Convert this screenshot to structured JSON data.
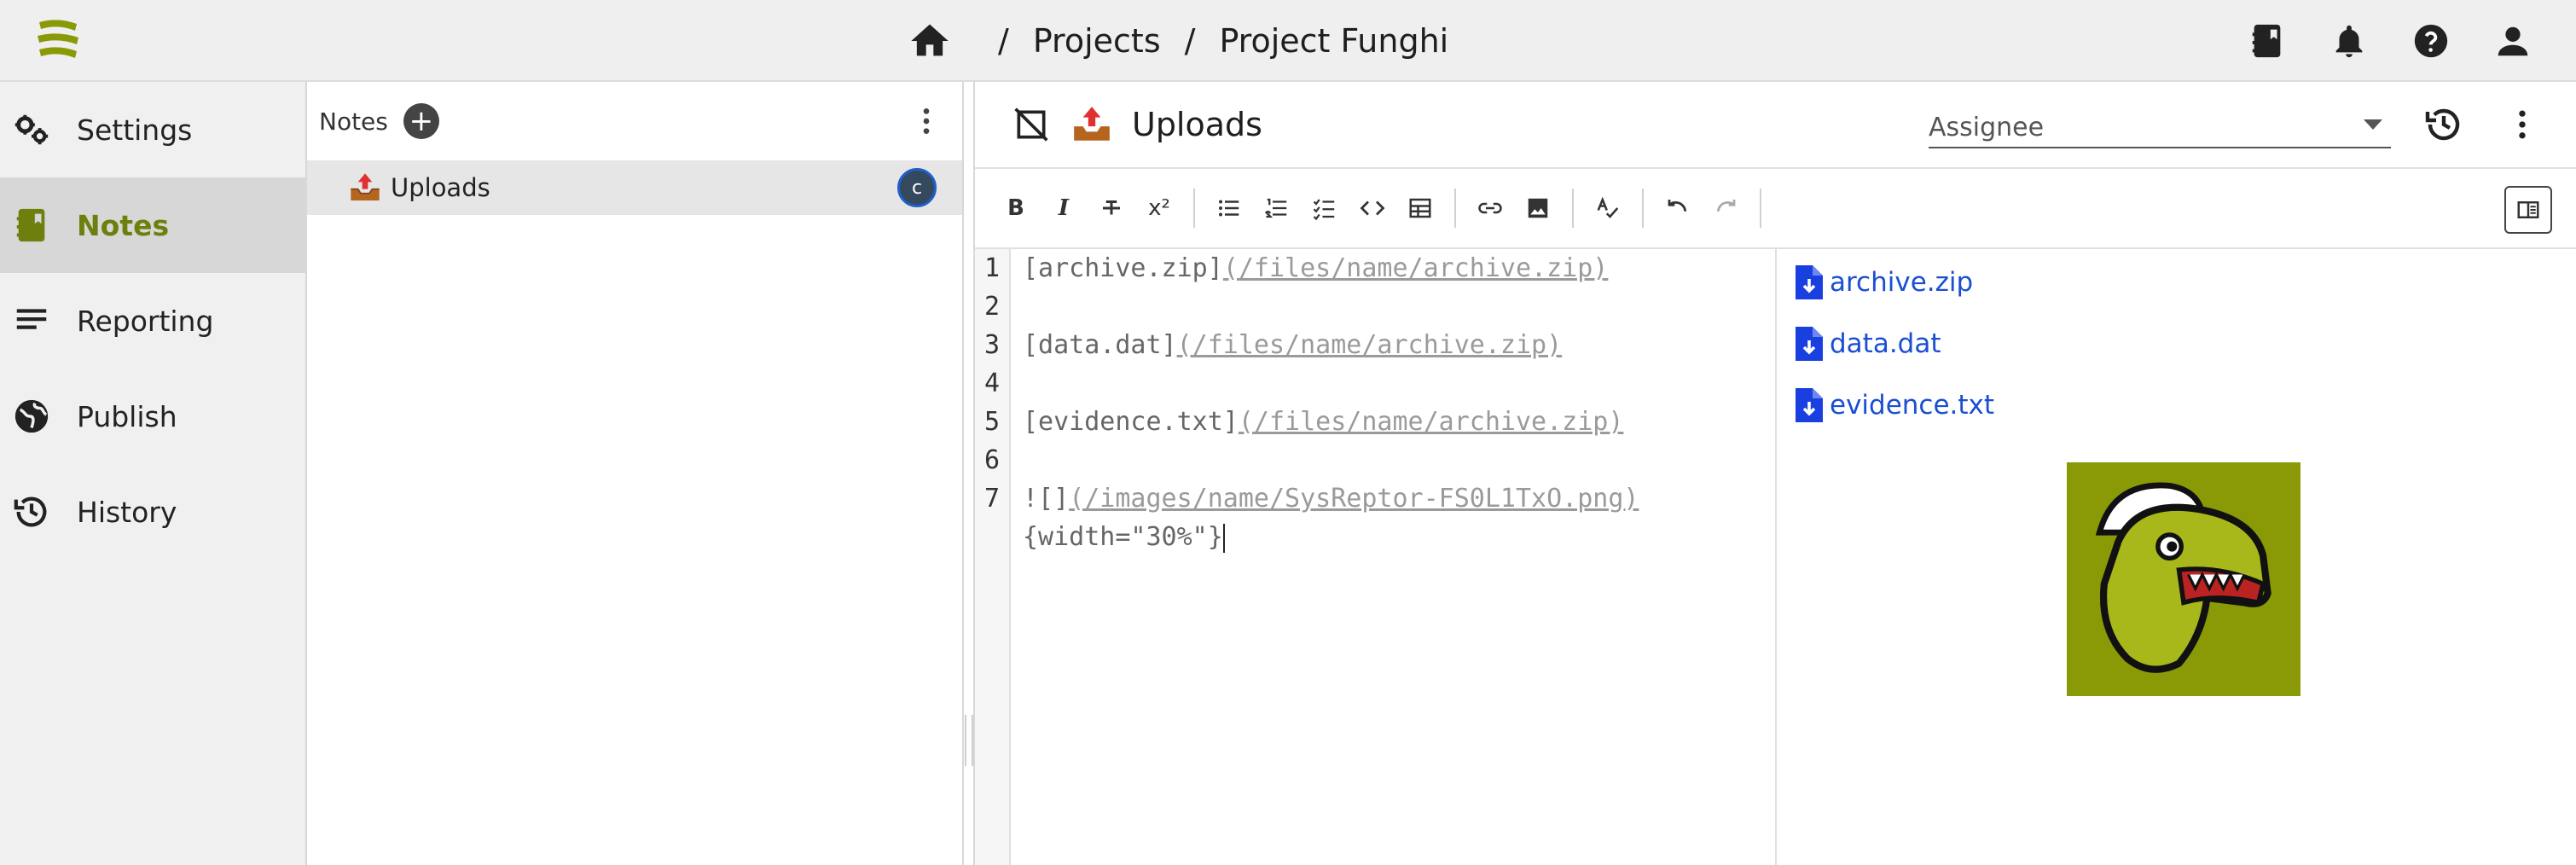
{
  "breadcrumbs": {
    "home_icon": "home-icon",
    "sep1": "/",
    "projects": "Projects",
    "sep2": "/",
    "project": "Project Funghi"
  },
  "top_actions": [
    "notebook-icon",
    "bell-icon",
    "help-icon",
    "account-icon"
  ],
  "nav": {
    "items": [
      {
        "label": "Settings",
        "icon": "settings-icon"
      },
      {
        "label": "Notes",
        "icon": "notebook-icon",
        "active": true
      },
      {
        "label": "Reporting",
        "icon": "lines-icon"
      },
      {
        "label": "Publish",
        "icon": "globe-icon"
      },
      {
        "label": "History",
        "icon": "history-icon"
      }
    ]
  },
  "notes": {
    "header": "Notes",
    "items": [
      {
        "title": "Uploads",
        "assignee_initial": "c"
      }
    ]
  },
  "editor": {
    "title": "Uploads",
    "assignee_placeholder": "Assignee",
    "toolbar": {
      "bold": "B",
      "italic": "I",
      "superscript": "x²"
    },
    "gutter": [
      "1",
      "2",
      "3",
      "4",
      "5",
      "6",
      "7"
    ],
    "lines": [
      {
        "text": "[archive.zip]",
        "link": "(/files/name/archive.zip)"
      },
      {
        "text": "",
        "link": ""
      },
      {
        "text": "[data.dat]",
        "link": "(/files/name/archive.zip)"
      },
      {
        "text": "",
        "link": ""
      },
      {
        "text": "[evidence.txt]",
        "link": "(/files/name/archive.zip)"
      },
      {
        "text": "",
        "link": ""
      },
      {
        "text": "![]",
        "link": "(/images/name/SysReptor-FS0L1TxO.png)"
      },
      {
        "text": "{width=\"30%\"}",
        "link": ""
      }
    ],
    "preview_links": [
      "archive.zip",
      "data.dat",
      "evidence.txt"
    ]
  },
  "colors": {
    "accent": "#6f7f0d",
    "link": "#1a4fd1",
    "dino_bg": "#8a9a06"
  }
}
